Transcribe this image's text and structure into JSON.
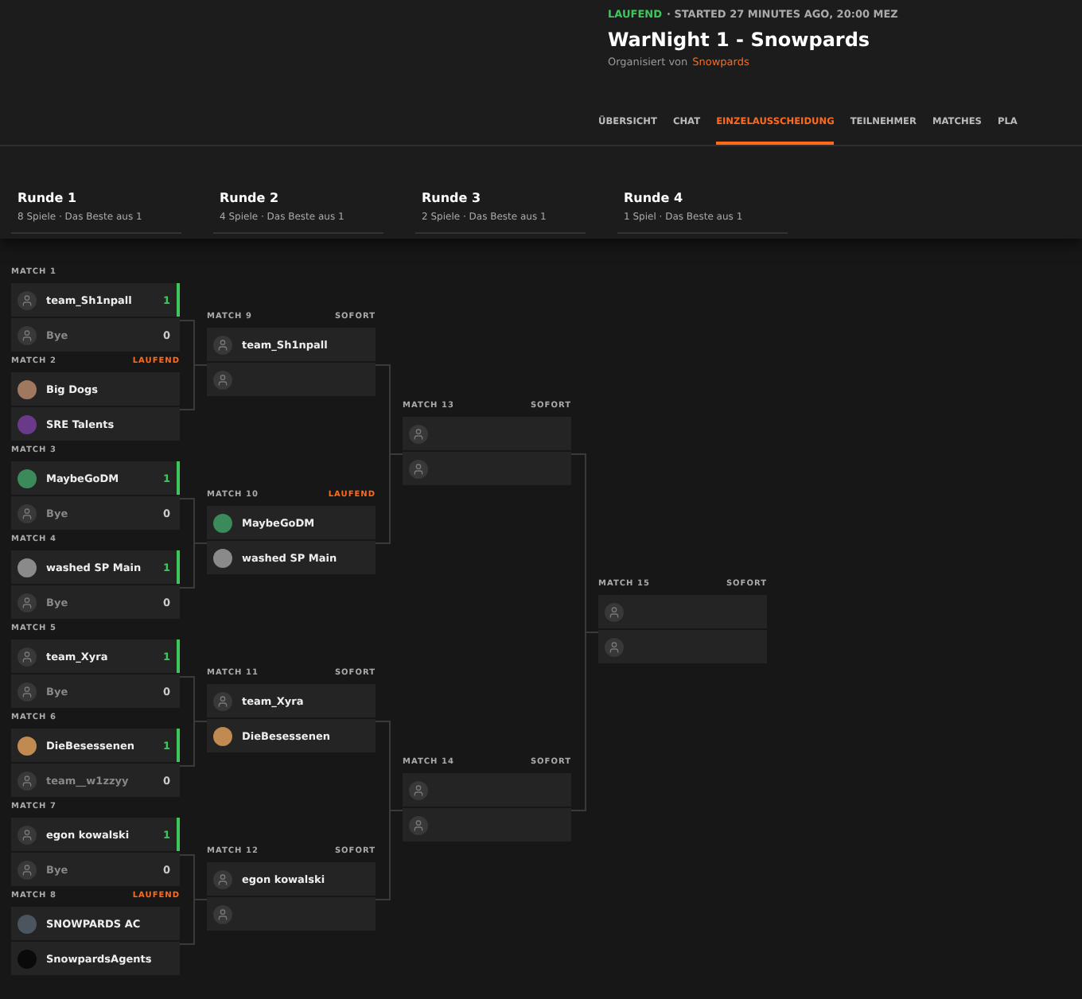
{
  "event": {
    "state": "LAUFEND",
    "started": "· STARTED 27 MINUTES AGO, 20:00 MEZ",
    "title": "WarNight 1 - Snowpards",
    "organizer_label": "Organisiert von",
    "organizer": "Snowpards"
  },
  "tabs": [
    {
      "label": "ÜBERSICHT",
      "selected": false
    },
    {
      "label": "CHAT",
      "selected": false
    },
    {
      "label": "EINZELAUSSCHEIDUNG",
      "selected": true
    },
    {
      "label": "TEILNEHMER",
      "selected": false
    },
    {
      "label": "MATCHES",
      "selected": false
    },
    {
      "label": "PLA",
      "selected": false
    }
  ],
  "rounds": [
    {
      "title": "Runde 1",
      "subtitle": "8 Spiele · Das Beste aus 1",
      "matches": [
        {
          "label": "MATCH 1",
          "teams": [
            {
              "name": "team_Sh1npall",
              "score": "1",
              "winner": true,
              "avatar": {
                "kind": "placeholder"
              }
            },
            {
              "name": "Bye",
              "score": "0",
              "winner": false,
              "avatar": {
                "kind": "placeholder"
              }
            }
          ]
        },
        {
          "label": "MATCH 2",
          "status": "LAUFEND",
          "live": true,
          "teams": [
            {
              "name": "Big Dogs",
              "winner": false,
              "avatar": {
                "kind": "logo",
                "color": "#a07860"
              }
            },
            {
              "name": "SRE Talents",
              "winner": false,
              "avatar": {
                "kind": "logo",
                "color": "#6a3a8a"
              }
            }
          ]
        },
        {
          "label": "MATCH 3",
          "teams": [
            {
              "name": "MaybeGoDM",
              "score": "1",
              "winner": true,
              "avatar": {
                "kind": "logo",
                "color": "#3a8a5a"
              }
            },
            {
              "name": "Bye",
              "score": "0",
              "winner": false,
              "avatar": {
                "kind": "placeholder"
              }
            }
          ]
        },
        {
          "label": "MATCH 4",
          "teams": [
            {
              "name": "washed SP Main",
              "score": "1",
              "winner": true,
              "avatar": {
                "kind": "logo",
                "color": "#8a8a8a"
              }
            },
            {
              "name": "Bye",
              "score": "0",
              "winner": false,
              "avatar": {
                "kind": "placeholder"
              }
            }
          ]
        },
        {
          "label": "MATCH 5",
          "teams": [
            {
              "name": "team_Xyra",
              "score": "1",
              "winner": true,
              "avatar": {
                "kind": "placeholder"
              }
            },
            {
              "name": "Bye",
              "score": "0",
              "winner": false,
              "avatar": {
                "kind": "placeholder"
              }
            }
          ]
        },
        {
          "label": "MATCH 6",
          "teams": [
            {
              "name": "DieBesessenen",
              "score": "1",
              "winner": true,
              "avatar": {
                "kind": "logo",
                "color": "#c08a50"
              }
            },
            {
              "name": "team__w1zzyy",
              "score": "0",
              "winner": false,
              "avatar": {
                "kind": "placeholder"
              }
            }
          ]
        },
        {
          "label": "MATCH 7",
          "teams": [
            {
              "name": "egon kowalski",
              "score": "1",
              "winner": true,
              "avatar": {
                "kind": "placeholder"
              }
            },
            {
              "name": "Bye",
              "score": "0",
              "winner": false,
              "avatar": {
                "kind": "placeholder"
              }
            }
          ]
        },
        {
          "label": "MATCH 8",
          "status": "LAUFEND",
          "live": true,
          "teams": [
            {
              "name": "SNOWPARDS AC",
              "winner": false,
              "avatar": {
                "kind": "logo",
                "color": "#4a5560"
              }
            },
            {
              "name": "SnowpardsAgents",
              "winner": false,
              "avatar": {
                "kind": "logo",
                "color": "#0a0a0a"
              }
            }
          ]
        }
      ]
    },
    {
      "title": "Runde 2",
      "subtitle": "4 Spiele · Das Beste aus 1",
      "matches": [
        {
          "label": "MATCH 9",
          "status": "SOFORT",
          "live": false,
          "teams": [
            {
              "name": "team_Sh1npall",
              "winner": false,
              "avatar": {
                "kind": "placeholder"
              }
            },
            {
              "winner": false,
              "avatar": {
                "kind": "placeholder"
              }
            }
          ]
        },
        {
          "label": "MATCH 10",
          "status": "LAUFEND",
          "live": true,
          "teams": [
            {
              "name": "MaybeGoDM",
              "winner": false,
              "avatar": {
                "kind": "logo",
                "color": "#3a8a5a"
              }
            },
            {
              "name": "washed SP Main",
              "winner": false,
              "avatar": {
                "kind": "logo",
                "color": "#8a8a8a"
              }
            }
          ]
        },
        {
          "label": "MATCH 11",
          "status": "SOFORT",
          "live": false,
          "teams": [
            {
              "name": "team_Xyra",
              "winner": false,
              "avatar": {
                "kind": "placeholder"
              }
            },
            {
              "name": "DieBesessenen",
              "winner": false,
              "avatar": {
                "kind": "logo",
                "color": "#c08a50"
              }
            }
          ]
        },
        {
          "label": "MATCH 12",
          "status": "SOFORT",
          "live": false,
          "teams": [
            {
              "name": "egon kowalski",
              "winner": false,
              "avatar": {
                "kind": "placeholder"
              }
            },
            {
              "winner": false,
              "avatar": {
                "kind": "placeholder"
              }
            }
          ]
        }
      ]
    },
    {
      "title": "Runde 3",
      "subtitle": "2 Spiele · Das Beste aus 1",
      "matches": [
        {
          "label": "MATCH 13",
          "status": "SOFORT",
          "live": false,
          "teams": [
            {
              "winner": false,
              "avatar": {
                "kind": "placeholder"
              }
            },
            {
              "winner": false,
              "avatar": {
                "kind": "placeholder"
              }
            }
          ]
        },
        {
          "label": "MATCH 14",
          "status": "SOFORT",
          "live": false,
          "teams": [
            {
              "winner": false,
              "avatar": {
                "kind": "placeholder"
              }
            },
            {
              "winner": false,
              "avatar": {
                "kind": "placeholder"
              }
            }
          ]
        }
      ]
    },
    {
      "title": "Runde 4",
      "subtitle": "1 Spiel · Das Beste aus 1",
      "matches": [
        {
          "label": "MATCH 15",
          "status": "SOFORT",
          "live": false,
          "teams": [
            {
              "winner": false,
              "avatar": {
                "kind": "placeholder"
              }
            },
            {
              "winner": false,
              "avatar": {
                "kind": "placeholder"
              }
            }
          ]
        }
      ]
    }
  ]
}
